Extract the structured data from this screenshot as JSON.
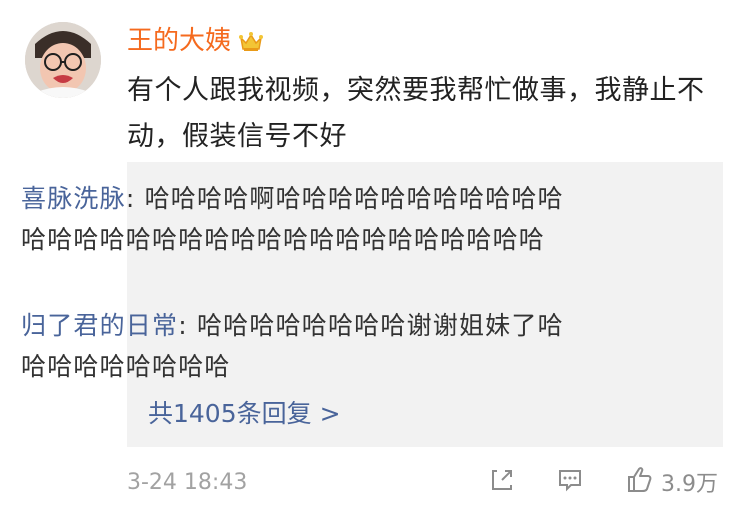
{
  "post": {
    "username": "王的大姨",
    "username_color": "#f56a1e",
    "badge_icon": "crown-icon",
    "text": "有个人跟我视频，突然要我帮忙做事，我静止不动，假装信号不好"
  },
  "replies": [
    {
      "name": "喜脉洗脉",
      "separator": ": ",
      "text": "哈哈哈哈啊哈哈哈哈哈哈哈哈哈哈哈哈哈哈哈哈哈哈哈哈哈哈哈哈哈哈哈哈哈哈哈"
    },
    {
      "name": "归了君的日常",
      "separator": ": ",
      "text": "哈哈哈哈哈哈哈哈谢谢姐妹了哈哈哈哈哈哈哈哈哈"
    }
  ],
  "more_replies": {
    "label": "共1405条回复 >",
    "color": "#49649a"
  },
  "footer": {
    "timestamp": "3-24 18:43",
    "like_count": "3.9万",
    "icons": [
      "share-icon",
      "comment-icon",
      "like-icon"
    ]
  }
}
